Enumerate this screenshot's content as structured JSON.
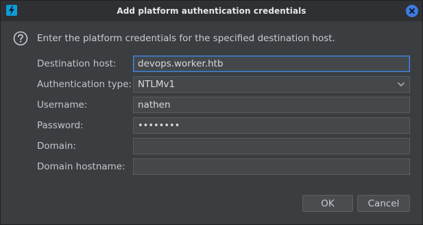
{
  "window": {
    "title": "Add platform authentication credentials",
    "app_icon": "lightning-bolt-icon",
    "close_icon": "close-icon"
  },
  "info": {
    "icon": "question-mark-icon",
    "text": "Enter the platform credentials for the specified destination host."
  },
  "form": {
    "destination_host": {
      "label": "Destination host:",
      "value": "devops.worker.htb"
    },
    "auth_type": {
      "label": "Authentication type:",
      "value": "NTLMv1"
    },
    "username": {
      "label": "Username:",
      "value": "nathen"
    },
    "password": {
      "label": "Password:",
      "value": "••••••••"
    },
    "domain": {
      "label": "Domain:",
      "value": ""
    },
    "domain_hostname": {
      "label": "Domain hostname:",
      "value": ""
    }
  },
  "buttons": {
    "ok": "OK",
    "cancel": "Cancel"
  },
  "colors": {
    "accent": "#3c7be0",
    "app_icon": "#0f9bd7"
  }
}
